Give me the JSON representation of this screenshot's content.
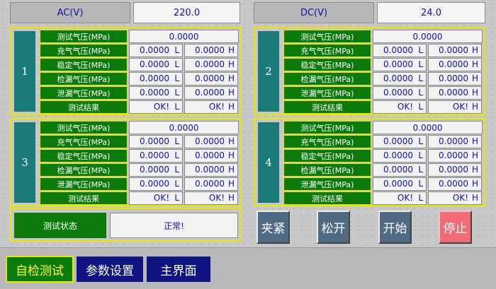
{
  "header": {
    "ac_label": "AC(V)",
    "ac_value": "220.0",
    "dc_label": "DC(V)",
    "dc_value": "24.0"
  },
  "labels": {
    "test_pressure": "测试气压(MPa)",
    "charge_pressure": "充气气压(MPa)",
    "stable_pressure": "稳定气压(MPa)",
    "leak_detect_pressure": "检漏气压(MPa)",
    "vent_pressure": "泄漏气压(MPa)",
    "test_result": "测试结果",
    "suffix_L": "L",
    "suffix_H": "H"
  },
  "stations": [
    {
      "id": "1",
      "test": "0.0000",
      "charge_L": "0.0000",
      "charge_H": "0.0000",
      "stable_L": "0.0000",
      "stable_H": "0.0000",
      "leak_L": "0.0000",
      "leak_H": "0.0000",
      "vent_L": "0.0000",
      "vent_H": "0.0000",
      "result_L": "OK!",
      "result_H": "OK!"
    },
    {
      "id": "2",
      "test": "0.0000",
      "charge_L": "0.0000",
      "charge_H": "0.0000",
      "stable_L": "0.0000",
      "stable_H": "0.0000",
      "leak_L": "0.0000",
      "leak_H": "0.0000",
      "vent_L": "0.0000",
      "vent_H": "0.0000",
      "result_L": "OK!",
      "result_H": "OK!"
    },
    {
      "id": "3",
      "test": "0.0000",
      "charge_L": "0.0000",
      "charge_H": "0.0000",
      "stable_L": "0.0000",
      "stable_H": "0.0000",
      "leak_L": "0.0000",
      "leak_H": "0.0000",
      "vent_L": "0.0000",
      "vent_H": "0.0000",
      "result_L": "OK!",
      "result_H": "OK!"
    },
    {
      "id": "4",
      "test": "0.0000",
      "charge_L": "0.0000",
      "charge_H": "0.0000",
      "stable_L": "0.0000",
      "stable_H": "0.0000",
      "leak_L": "0.0000",
      "leak_H": "0.0000",
      "vent_L": "0.0000",
      "vent_H": "0.0000",
      "result_L": "OK!",
      "result_H": "OK!"
    }
  ],
  "status": {
    "label": "测试状态",
    "value": "正常!"
  },
  "buttons": {
    "clamp": "夹紧",
    "release": "松开",
    "start": "开始",
    "stop": "停止"
  },
  "nav": {
    "self_test": "自检测试",
    "params": "参数设置",
    "main": "主界面"
  },
  "colors": {
    "label_green": "#0b7a0b",
    "value_blue": "#1212b0",
    "station_teal": "#1a7a78",
    "stop_red": "#f06d78",
    "panel_yellow": "#e6e600"
  }
}
